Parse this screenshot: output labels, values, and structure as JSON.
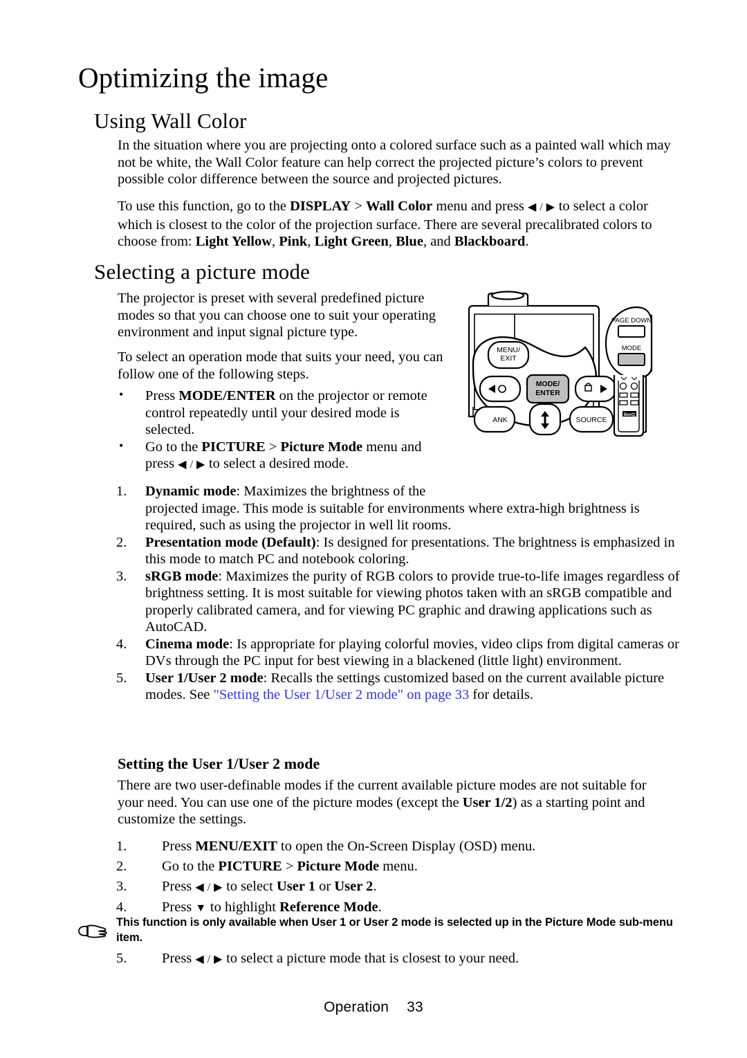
{
  "document": {
    "title": "Optimizing the image",
    "footer": {
      "section": "Operation",
      "page_number": "33"
    }
  },
  "sections": {
    "wall_color": {
      "heading": "Using Wall Color",
      "paragraph_1": "In the situation where you are projecting onto a colored surface such as a painted wall which may not be white, the Wall Color feature can help correct the projected picture’s colors to prevent possible color difference between the source and projected pictures.",
      "paragraph_2_part1": "To use this function, go to the ",
      "paragraph_2_menu1": "DISPLAY",
      "paragraph_2_sep": " > ",
      "paragraph_2_menu2": "Wall Color",
      "paragraph_2_part2": " menu and press ",
      "paragraph_2_arrows": "◀ / ▶",
      "paragraph_2_part3": " to select a color which is closest to the color of the projection surface. There are several precalibrated colors to choose from: ",
      "color_1": "Light Yellow",
      "color_2": "Pink",
      "color_3": "Light Green",
      "color_4": "Blue",
      "color_5": "Blackboard",
      "paragraph_2_end": "."
    },
    "picture_mode": {
      "heading": "Selecting a picture mode",
      "paragraph_1": "The projector is preset with several predefined picture modes so that you can choose one to suit your operating environment and input signal picture type.",
      "paragraph_2": "To select an operation mode that suits your need, you can follow one of the following steps.",
      "bullets": [
        {
          "marker": "•",
          "pre": "Press ",
          "bold": "MODE/ENTER",
          "post": " on the projector or remote control repeatedly until your desired mode is selected."
        },
        {
          "marker": "•",
          "pre": "Go to the ",
          "bold": "PICTURE",
          "sep": " > ",
          "bold2": "Picture Mode",
          "mid": " menu and press ",
          "arrows": "◀ / ▶",
          "post": " to select a desired mode."
        }
      ],
      "modes": [
        {
          "number": "1.",
          "name": "Dynamic mode",
          "colon": ": ",
          "first_line": "Maximizes the brightness of the",
          "description": "projected image. This mode is suitable for environments where extra-high brightness is required, such as using the projector in well lit rooms."
        },
        {
          "number": "2.",
          "name": "Presentation mode (Default)",
          "colon": ": ",
          "description": "Is designed for presentations. The brightness is emphasized in this mode to match PC and notebook coloring."
        },
        {
          "number": "3.",
          "name": "sRGB mode",
          "colon": ": ",
          "description": "Maximizes the purity of RGB colors to provide true-to-life images regardless of brightness setting. It is most suitable for viewing photos taken with an sRGB compatible and properly calibrated camera, and for viewing PC graphic and drawing applications such as AutoCAD."
        },
        {
          "number": "4.",
          "name": "Cinema mode",
          "colon": ": ",
          "description": "Is appropriate for playing colorful movies, video clips from digital cameras or DVs through the PC input for best viewing in a blackened (little light) environment."
        },
        {
          "number": "5.",
          "name": "User 1/User 2 mode",
          "colon": ": ",
          "description": "Recalls the settings customized based on the current available picture modes. See ",
          "link_text": "\"Setting the User 1/User 2 mode\" on page 33",
          "description_end": " for details."
        }
      ]
    },
    "user_modes": {
      "heading": "Setting the User 1/User 2 mode",
      "paragraph_part1": "There are two user-definable modes if the current available picture modes are not suitable for your need. You can use one of the picture modes (except the ",
      "paragraph_bold": "User 1/2",
      "paragraph_part2": ") as a starting point and customize the settings.",
      "steps": [
        {
          "number": "1.",
          "pre": "Press ",
          "bold": "MENU/EXIT",
          "post": " to open the On-Screen Display (OSD) menu."
        },
        {
          "number": "2.",
          "pre": "Go to the ",
          "bold": "PICTURE",
          "sep": " > ",
          "bold2": "Picture Mode",
          "post": " menu."
        },
        {
          "number": "3.",
          "pre": "Press ",
          "arrows": "◀ / ▶",
          "mid": " to select ",
          "bold": "User 1",
          "or": " or ",
          "bold2": "User 2",
          "post": "."
        },
        {
          "number": "4.",
          "pre": "Press ",
          "arrows": "▼",
          "mid": " to highlight ",
          "bold": "Reference Mode",
          "post": "."
        }
      ],
      "note": {
        "icon": "pointing-hand-icon",
        "text": "This function is only available when User 1 or User 2 mode is selected up in the Picture Mode sub-menu item."
      },
      "step_5": {
        "number": "5.",
        "pre": "Press ",
        "arrows": "◀ / ▶",
        "post": " to select a picture mode that is closest to your need."
      }
    }
  },
  "illustration": {
    "name": "projector-control-panel-and-remote-diagram",
    "projector_buttons": [
      {
        "label": "MENU/\nEXIT",
        "line1": "MENU/",
        "line2": "EXIT",
        "highlighted": false
      },
      {
        "label": "MODE/\nENTER",
        "line1": "MODE/",
        "line2": "ENTER",
        "highlighted": true
      },
      {
        "label": "SOURCE",
        "line1": "SOURCE",
        "highlighted": false
      },
      {
        "label": "BLANK",
        "line1": "ANK",
        "highlighted": false
      }
    ],
    "remote_buttons": [
      {
        "label": "PAGE DOWN",
        "highlighted": false
      },
      {
        "label": "MODE",
        "highlighted": true
      }
    ],
    "remote_brand": "BenQ",
    "highlight_color": "#bfbfbf"
  }
}
